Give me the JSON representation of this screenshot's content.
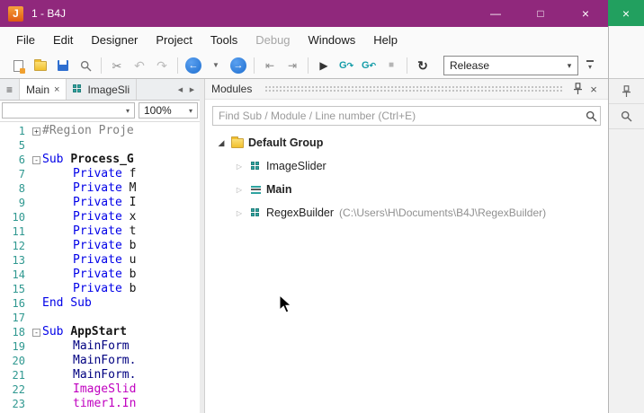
{
  "window": {
    "title": "1 - B4J",
    "icon_letter": "J",
    "controls": {
      "minimize": "—",
      "maximize": "□",
      "close": "×"
    },
    "behind_window_close": "×"
  },
  "colors": {
    "titlebar": "#90287c",
    "accent_green": "#22a05f",
    "line_number": "#2f9890",
    "keyword": "#0000e8",
    "member": "#000080",
    "type": "#c000c0",
    "comment": "#808080"
  },
  "menu": {
    "items": [
      {
        "label": "File",
        "enabled": true
      },
      {
        "label": "Edit",
        "enabled": true
      },
      {
        "label": "Designer",
        "enabled": true
      },
      {
        "label": "Project",
        "enabled": true
      },
      {
        "label": "Tools",
        "enabled": true
      },
      {
        "label": "Debug",
        "enabled": false
      },
      {
        "label": "Windows",
        "enabled": true
      },
      {
        "label": "Help",
        "enabled": true
      }
    ]
  },
  "toolbar": {
    "release_label": "Release",
    "items": [
      {
        "type": "icon",
        "name": "new-button",
        "icon": "new"
      },
      {
        "type": "icon",
        "name": "open-button",
        "icon": "open"
      },
      {
        "type": "icon",
        "name": "save-button",
        "icon": "save"
      },
      {
        "type": "icon",
        "name": "find-in-files-button",
        "icon": "find"
      },
      {
        "type": "sep"
      },
      {
        "type": "icon",
        "name": "cut-button",
        "icon": "cut"
      },
      {
        "type": "icon",
        "name": "undo-button",
        "icon": "undo",
        "enabled": false
      },
      {
        "type": "icon",
        "name": "redo-button",
        "icon": "redo",
        "enabled": false
      },
      {
        "type": "sep"
      },
      {
        "type": "icon",
        "name": "navigate-back-button",
        "icon": "back"
      },
      {
        "type": "icon",
        "name": "back-history-dropdown",
        "icon": "dropdown"
      },
      {
        "type": "icon",
        "name": "navigate-forward-button",
        "icon": "forward"
      },
      {
        "type": "sep"
      },
      {
        "type": "icon",
        "name": "outdent-button",
        "icon": "outdent"
      },
      {
        "type": "icon",
        "name": "indent-button",
        "icon": "indent"
      },
      {
        "type": "sep"
      },
      {
        "type": "icon",
        "name": "run-button",
        "icon": "run"
      },
      {
        "type": "icon",
        "name": "jump-previous-sub-button",
        "icon": "step1"
      },
      {
        "type": "icon",
        "name": "jump-next-sub-button",
        "icon": "step2"
      },
      {
        "type": "icon",
        "name": "stop-button",
        "icon": "stop",
        "enabled": false
      },
      {
        "type": "sep"
      },
      {
        "type": "icon",
        "name": "rebuild-button",
        "icon": "rebuild"
      },
      {
        "type": "combo",
        "name": "build-configuration-combo"
      },
      {
        "type": "overflow",
        "name": "toolbar-overflow-button"
      }
    ]
  },
  "tabs": {
    "close_glyph": "×",
    "items": [
      {
        "label": "Main",
        "active": true,
        "closable": true
      },
      {
        "label": "ImageSli",
        "icon": "module"
      }
    ]
  },
  "editor": {
    "module_combo_value": "",
    "zoom_value": "100%",
    "lines": [
      {
        "num": "1",
        "fold": "plus",
        "seg": [
          [
            "comment",
            "#Region Proje"
          ]
        ]
      },
      {
        "num": "5",
        "seg": []
      },
      {
        "num": "6",
        "fold": "minus",
        "seg": [
          [
            "keyword",
            "Sub "
          ],
          [
            "bold",
            "Process_G"
          ]
        ]
      },
      {
        "num": "7",
        "ind": 1,
        "seg": [
          [
            "keyword",
            "Private "
          ],
          [
            "plain",
            "f"
          ]
        ]
      },
      {
        "num": "8",
        "ind": 1,
        "seg": [
          [
            "keyword",
            "Private "
          ],
          [
            "plain",
            "M"
          ]
        ]
      },
      {
        "num": "9",
        "ind": 1,
        "seg": [
          [
            "keyword",
            "Private "
          ],
          [
            "plain",
            "I"
          ]
        ]
      },
      {
        "num": "10",
        "ind": 1,
        "seg": [
          [
            "keyword",
            "Private "
          ],
          [
            "plain",
            "x"
          ]
        ]
      },
      {
        "num": "11",
        "ind": 1,
        "seg": [
          [
            "keyword",
            "Private "
          ],
          [
            "plain",
            "t"
          ]
        ]
      },
      {
        "num": "12",
        "ind": 1,
        "seg": [
          [
            "keyword",
            "Private "
          ],
          [
            "plain",
            "b"
          ]
        ]
      },
      {
        "num": "13",
        "ind": 1,
        "seg": [
          [
            "keyword",
            "Private "
          ],
          [
            "plain",
            "u"
          ]
        ]
      },
      {
        "num": "14",
        "ind": 1,
        "seg": [
          [
            "keyword",
            "Private "
          ],
          [
            "plain",
            "b"
          ]
        ]
      },
      {
        "num": "15",
        "ind": 1,
        "seg": [
          [
            "keyword",
            "Private "
          ],
          [
            "plain",
            "b"
          ]
        ]
      },
      {
        "num": "16",
        "seg": [
          [
            "keyword",
            "End Sub"
          ]
        ]
      },
      {
        "num": "17",
        "seg": []
      },
      {
        "num": "18",
        "fold": "minus",
        "seg": [
          [
            "keyword",
            "Sub "
          ],
          [
            "bold",
            "AppStart"
          ]
        ]
      },
      {
        "num": "19",
        "ind": 1,
        "seg": [
          [
            "member",
            "MainForm"
          ]
        ]
      },
      {
        "num": "20",
        "ind": 1,
        "seg": [
          [
            "member",
            "MainForm."
          ]
        ]
      },
      {
        "num": "21",
        "ind": 1,
        "seg": [
          [
            "member",
            "MainForm."
          ]
        ]
      },
      {
        "num": "22",
        "ind": 1,
        "seg": [
          [
            "type",
            "ImageSlid"
          ]
        ]
      },
      {
        "num": "23",
        "ind": 1,
        "seg": [
          [
            "type",
            "timer1.In"
          ]
        ]
      }
    ]
  },
  "modules_panel": {
    "title": "Modules",
    "close_glyph": "×",
    "search_placeholder": "Find Sub / Module / Line number (Ctrl+E)",
    "tree": [
      {
        "label": "Default Group",
        "icon": "folder",
        "bold": true,
        "state": "expanded",
        "level": 0
      },
      {
        "label": "ImageSlider",
        "icon": "module",
        "state": "collapsed",
        "level": 1
      },
      {
        "label": "Main",
        "icon": "main",
        "bold": true,
        "state": "collapsed",
        "level": 1
      },
      {
        "label": "RegexBuilder",
        "icon": "module",
        "state": "collapsed",
        "level": 1,
        "path": "(C:\\Users\\H\\Documents\\B4J\\RegexBuilder)"
      }
    ]
  }
}
